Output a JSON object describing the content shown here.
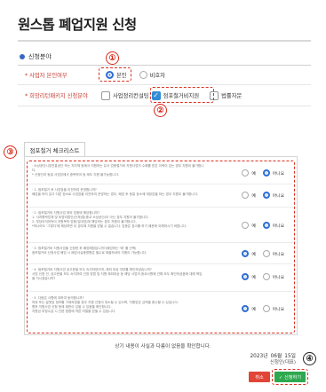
{
  "page": {
    "title": "원스톱 폐업지원 신청"
  },
  "section": {
    "label": "신청분야"
  },
  "form": {
    "row1": {
      "label": "* 사업자 본인여부",
      "opt_yes": "본인",
      "opt_no": "비호자"
    },
    "row2": {
      "label": "* 희망리턴패키지 신청분야",
      "opt_a": "사업정리컨설팅",
      "opt_b": "점포철거비지원",
      "opt_c": "법률자문"
    }
  },
  "tab": {
    "label": "점포철거 체크리스트"
  },
  "checklist": {
    "yes": "예",
    "no": "아니요",
    "items": [
      {
        "text": "· 소상공인시장진흥공단 또는 지자체 등에서 지원하는 유사 업종철거비 지원사업의 수혜를 받은 이력이 있는 경우 지원이 불가합니다.\n  * 신청인과 동일 사업장에서 중복하여 동 제도 지원 불가능합니다.",
        "selected": "no"
      },
      {
        "text": "· 1. 점포철거 후 사업장을 이전하여 운영합니까?\n  폐업을 하지 않고 다른 장소로 사업장을 이전하여 운영하는 경우, 폐업 후 동일 장소에 재창업을 하는 경우 지원이 불가합니다.",
        "selected": "no"
      },
      {
        "text": "· 2. 점포철거비 지원사업 제외 업종에 해당합니까?\n  1. 사치향락업체 및 비영리법인(단체)법(종교 소상공인)이 아닌 경우 지원이 불가합니다.\n  2. 부당이익취득이 지원목적 업종(임대업)에 해당하는 경우 지원이 불가합니다.\n  *하나라도 '그렇다'에 해당하면 이 경우에 지원을 받을 수 없습니다. 업종은 참고를 하기 때문에 이해하시기 바랍니다.",
        "selected": "no"
      },
      {
        "text": "· 3. 점포철거비 지원사업을 신청한 후 폐업예정입니까?(폐업하는 '예' 를 선택)\n  점포철거비 신청사업 폐업 시 폐업사실증명원은 필수로 제출하셔야 지원이 가능합니다.",
        "selected": "yes"
      },
      {
        "text": "· 4. 점포철거비 지원사업 공고문을 모두 숙지하였으며, 제외 대상 여부를 확인하셨습니까?\n  사업 신청 전, 공고문을 모두 숙지하여 선정 방법 및 지원 제외대상 등 해당 사업의 중요사항에 관해 모두 확인하셨음에 대해 책임을 지시겠습니까?",
        "selected": "yes"
      },
      {
        "text": "· 5. 다음은 사항에 대하여 동의합니까?\n  허위 또는 잘못된 정보를 기재하였을 경우 지원 선정이 취소될 수 있으며, 지원받은 금액을 환수할 수 있습니다.\n  향후 지원사업 신청 등에 제한이 있을 수 있음을 확인합니다.\n  지원금 부정수급 시 관련 법령에 따른 처벌을 받을 수 있습니다.",
        "selected": "yes"
      }
    ]
  },
  "confirm": {
    "text": "상기 내용이 사실과 다름이 없음을 확인합니다."
  },
  "date": {
    "year": "2023년",
    "month": "06월",
    "day": "15일"
  },
  "signer": {
    "label": "신청인(대표)"
  },
  "buttons": {
    "cancel": "취소",
    "submit": "✓ 신청하기"
  },
  "annotations": {
    "n1": "①",
    "n2": "②",
    "n3": "③",
    "n4": "④"
  },
  "colors": {
    "accent": "#2f6fd6",
    "highlight": "#d93020",
    "submit": "#2ea84f",
    "cancel": "#e04538"
  }
}
